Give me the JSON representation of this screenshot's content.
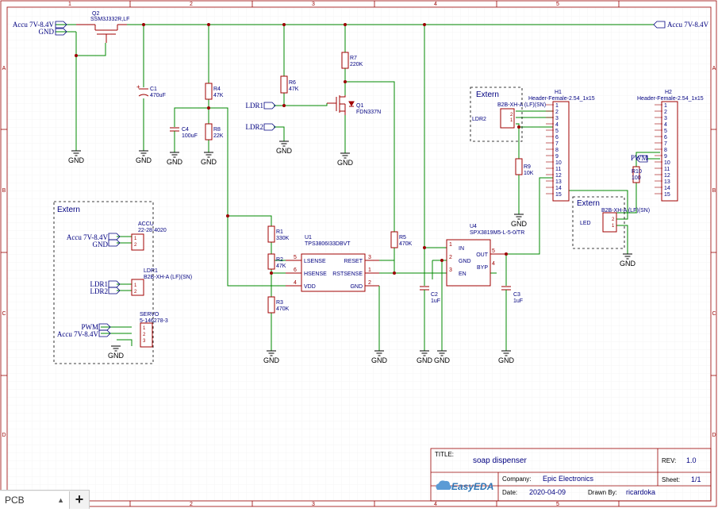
{
  "frame": {
    "cols": [
      "1",
      "2",
      "3",
      "4",
      "5"
    ],
    "rows": [
      "A",
      "B",
      "C",
      "D"
    ]
  },
  "ports": {
    "accu_left": "Accu 7V-8.4V",
    "gnd_left": "GND",
    "accu_right": "Accu 7V-8.4V",
    "ldr1": "LDR1",
    "ldr2": "LDR2",
    "pwm": "PWM",
    "gnd": "GND"
  },
  "components": {
    "q2": {
      "ref": "Q2",
      "value": "SSM3J332R,LF"
    },
    "c1": {
      "ref": "C1",
      "value": "470uF"
    },
    "c4": {
      "ref": "C4",
      "value": "100uF"
    },
    "r4": {
      "ref": "R4",
      "value": "47K"
    },
    "r8": {
      "ref": "R8",
      "value": "22K"
    },
    "r6": {
      "ref": "R6",
      "value": "47K"
    },
    "r7": {
      "ref": "R7",
      "value": "220K"
    },
    "q1": {
      "ref": "Q1",
      "value": "FDN337N"
    },
    "r1": {
      "ref": "R1",
      "value": "330K"
    },
    "r2": {
      "ref": "R2",
      "value": "47K"
    },
    "r3": {
      "ref": "R3",
      "value": "470K"
    },
    "r5": {
      "ref": "R5",
      "value": "470K"
    },
    "u1": {
      "ref": "U1",
      "value": "TPS3806I33DBVT",
      "pins": {
        "lsense": "LSENSE",
        "hsense": "HSENSE",
        "vdd": "VDD",
        "reset": "RESET",
        "rstsense": "RSTSENSE",
        "gnd": "GND"
      }
    },
    "u4": {
      "ref": "U4",
      "value": "SPX3819M5-L-5-0/TR",
      "pins": {
        "in": "IN",
        "gnd": "GND",
        "en": "EN",
        "out": "OUT",
        "byp": "BYP"
      }
    },
    "c2": {
      "ref": "C2",
      "value": "1uF"
    },
    "c3": {
      "ref": "C3",
      "value": "1uF"
    },
    "r9": {
      "ref": "R9",
      "value": "10K"
    },
    "r10": {
      "ref": "R10",
      "value": "100"
    },
    "h1": {
      "ref": "H1",
      "value": "Header-Female-2.54_1x15"
    },
    "h2": {
      "ref": "H2",
      "value": "Header-Female-2.54_1x15"
    },
    "ldr2_conn": {
      "label": "LDR2",
      "value": "B2B-XH-A (LF)(SN)"
    },
    "led_conn": {
      "label": "LED",
      "value": "B2B-XH-A (LF)(SN)"
    },
    "accu_conn": {
      "label": "ACCU",
      "value": "22-28-4020"
    },
    "ldr1_conn": {
      "label": "LDR1",
      "value": "B2B-XH-A (LF)(SN)"
    },
    "servo_conn": {
      "label": "SERVO",
      "value": "5-146278-3"
    }
  },
  "extern_labels": {
    "box1": "Extern",
    "box2": "Extern",
    "box3": "Extern"
  },
  "title_block": {
    "title_label": "TITLE:",
    "title": "soap dispenser",
    "rev_label": "REV:",
    "rev": "1.0",
    "company_label": "Company:",
    "company": "Epic Electronics",
    "sheet_label": "Sheet:",
    "sheet": "1/1",
    "date_label": "Date:",
    "date": "2020-04-09",
    "drawn_label": "Drawn By:",
    "drawn_by": "ricardoka",
    "logo": "EasyEDA"
  },
  "bottom_bar": {
    "tab_label": "PCB",
    "add_label": "+"
  },
  "colors": {
    "wire": "#008800",
    "part": "#a00000",
    "text": "#000080",
    "frame": "#990000"
  }
}
